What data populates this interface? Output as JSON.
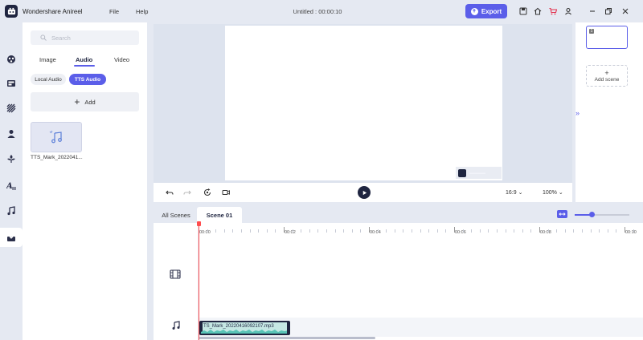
{
  "app": {
    "name": "Wondershare Anireel",
    "menu": [
      "File",
      "Help"
    ],
    "document_title": "Untitled : 00:00:10",
    "export_label": "Export",
    "accent_color": "#5b5ee9",
    "dark_color": "#1f2540"
  },
  "toolbar_icons": [
    "save-icon",
    "home-icon",
    "cart-icon",
    "account-icon",
    "minimize-icon",
    "restore-icon",
    "close-icon"
  ],
  "rail_icons": [
    "character-icon",
    "scene-icon",
    "background-icon",
    "person-icon",
    "prop-icon",
    "text-icon",
    "music-icon",
    "import-icon"
  ],
  "panel": {
    "search_placeholder": "Search",
    "tabs": [
      "Image",
      "Audio",
      "Video"
    ],
    "active_tab": "Audio",
    "audio_chips": [
      "Local Audio",
      "TTS Audio"
    ],
    "active_chip": "TTS Audio",
    "add_label": "Add",
    "media_items": [
      {
        "label": "TTS_Mark_2022041...",
        "icon": "music-note-icon"
      }
    ]
  },
  "preview": {
    "ratio_label": "16:9",
    "zoom_label": "100%"
  },
  "scenes": {
    "selected_scene_number": "1",
    "add_scene_label": "Add scene"
  },
  "timeline": {
    "tabs": [
      "All Scenes",
      "Scene 01"
    ],
    "active_tab": "Scene 01",
    "ruler_labels": [
      "00:00",
      "00:02",
      "00:04",
      "00:06",
      "00:08",
      "00:10"
    ],
    "audio_clip_name": "TS_Mark_20220416092107.mp3",
    "zoom_level": 0.32
  }
}
